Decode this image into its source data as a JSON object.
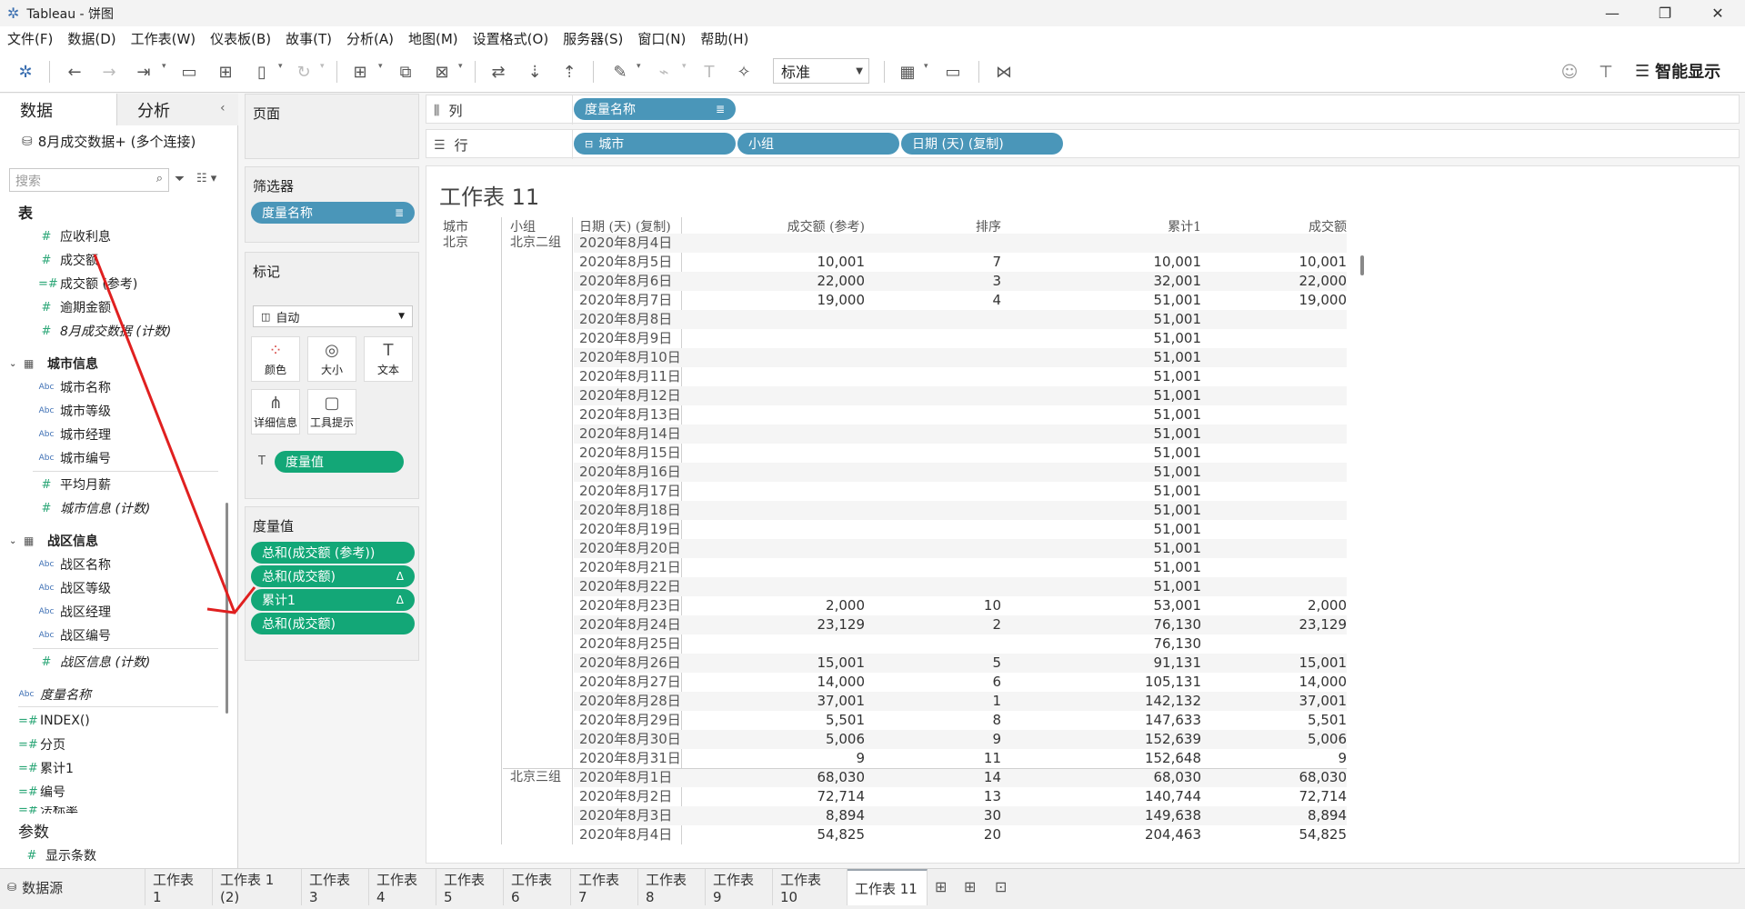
{
  "window": {
    "title": "Tableau - 饼图",
    "minimize": "—",
    "restore": "❐",
    "close": "✕"
  },
  "menu": [
    "文件(F)",
    "数据(D)",
    "工作表(W)",
    "仪表板(B)",
    "故事(T)",
    "分析(A)",
    "地图(M)",
    "设置格式(O)",
    "服务器(S)",
    "窗口(N)",
    "帮助(H)"
  ],
  "toolbar": {
    "view_mode": "标准",
    "smart_show": "智能显示"
  },
  "data_pane": {
    "tab_data": "数据",
    "tab_analysis": "分析",
    "datasource": "8月成交数据+ (多个连接)",
    "search_placeholder": "搜索",
    "tables_header": "表",
    "fields_top": [
      "应收利息",
      "成交额",
      "成交额 (参考)",
      "逾期金额",
      "8月成交数据 (计数)"
    ],
    "city_group": "城市信息",
    "city_fields": [
      "城市名称",
      "城市等级",
      "城市经理",
      "城市编号",
      "平均月薪",
      "城市信息 (计数)"
    ],
    "zone_group": "战区信息",
    "zone_fields": [
      "战区名称",
      "战区等级",
      "战区经理",
      "战区编号",
      "战区信息 (计数)"
    ],
    "other_fields": [
      "度量名称",
      "INDEX()",
      "分页",
      "累计1",
      "编号",
      "法标率"
    ],
    "params_header": "参数",
    "params": [
      "显示条数"
    ]
  },
  "shelves": {
    "pages": "页面",
    "filters": "筛选器",
    "filter_pill": "度量名称",
    "marks": "标记",
    "mark_type": "自动",
    "mark_buttons": [
      "颜色",
      "大小",
      "文本",
      "详细信息",
      "工具提示"
    ],
    "mark_pill": "度量值",
    "measure_values": "度量值",
    "measure_pills": [
      "总和(成交额 (参考))",
      "总和(成交额)",
      "累计1",
      "总和(成交额)"
    ],
    "columns_label": "列",
    "rows_label": "行",
    "columns_pill": "度量名称",
    "rows_pills": [
      "城市",
      "小组",
      "日期 (天) (复制)"
    ]
  },
  "viz": {
    "title": "工作表 11",
    "headers": [
      "城市",
      "小组",
      "日期 (天) (复制)",
      "成交额 (参考)",
      "排序",
      "累计1",
      "成交额"
    ],
    "city": "北京",
    "groups": [
      "北京二组",
      "北京三组"
    ],
    "rows": [
      [
        "2020年8月4日",
        "",
        "",
        "",
        ""
      ],
      [
        "2020年8月5日",
        "10,001",
        "7",
        "10,001",
        "10,001"
      ],
      [
        "2020年8月6日",
        "22,000",
        "3",
        "32,001",
        "22,000"
      ],
      [
        "2020年8月7日",
        "19,000",
        "4",
        "51,001",
        "19,000"
      ],
      [
        "2020年8月8日",
        "",
        "",
        "51,001",
        ""
      ],
      [
        "2020年8月9日",
        "",
        "",
        "51,001",
        ""
      ],
      [
        "2020年8月10日",
        "",
        "",
        "51,001",
        ""
      ],
      [
        "2020年8月11日",
        "",
        "",
        "51,001",
        ""
      ],
      [
        "2020年8月12日",
        "",
        "",
        "51,001",
        ""
      ],
      [
        "2020年8月13日",
        "",
        "",
        "51,001",
        ""
      ],
      [
        "2020年8月14日",
        "",
        "",
        "51,001",
        ""
      ],
      [
        "2020年8月15日",
        "",
        "",
        "51,001",
        ""
      ],
      [
        "2020年8月16日",
        "",
        "",
        "51,001",
        ""
      ],
      [
        "2020年8月17日",
        "",
        "",
        "51,001",
        ""
      ],
      [
        "2020年8月18日",
        "",
        "",
        "51,001",
        ""
      ],
      [
        "2020年8月19日",
        "",
        "",
        "51,001",
        ""
      ],
      [
        "2020年8月20日",
        "",
        "",
        "51,001",
        ""
      ],
      [
        "2020年8月21日",
        "",
        "",
        "51,001",
        ""
      ],
      [
        "2020年8月22日",
        "",
        "",
        "51,001",
        ""
      ],
      [
        "2020年8月23日",
        "2,000",
        "10",
        "53,001",
        "2,000"
      ],
      [
        "2020年8月24日",
        "23,129",
        "2",
        "76,130",
        "23,129"
      ],
      [
        "2020年8月25日",
        "",
        "",
        "76,130",
        ""
      ],
      [
        "2020年8月26日",
        "15,001",
        "5",
        "91,131",
        "15,001"
      ],
      [
        "2020年8月27日",
        "14,000",
        "6",
        "105,131",
        "14,000"
      ],
      [
        "2020年8月28日",
        "37,001",
        "1",
        "142,132",
        "37,001"
      ],
      [
        "2020年8月29日",
        "5,501",
        "8",
        "147,633",
        "5,501"
      ],
      [
        "2020年8月30日",
        "5,006",
        "9",
        "152,639",
        "5,006"
      ],
      [
        "2020年8月31日",
        "9",
        "11",
        "152,648",
        "9"
      ],
      [
        "2020年8月1日",
        "68,030",
        "14",
        "68,030",
        "68,030"
      ],
      [
        "2020年8月2日",
        "72,714",
        "13",
        "140,744",
        "72,714"
      ],
      [
        "2020年8月3日",
        "8,894",
        "30",
        "149,638",
        "8,894"
      ],
      [
        "2020年8月4日",
        "54,825",
        "20",
        "204,463",
        "54,825"
      ]
    ]
  },
  "bottom_tabs": {
    "datasource": "数据源",
    "sheets": [
      "工作表 1",
      "工作表 1 (2)",
      "工作表 3",
      "工作表 4",
      "工作表 5",
      "工作表 6",
      "工作表 7",
      "工作表 8",
      "工作表 9",
      "工作表 10",
      "工作表 11"
    ],
    "active": "工作表 11"
  },
  "colors": {
    "blue_pill": "#4a96b9",
    "green_pill": "#13a777",
    "arrow": "#e02020"
  }
}
